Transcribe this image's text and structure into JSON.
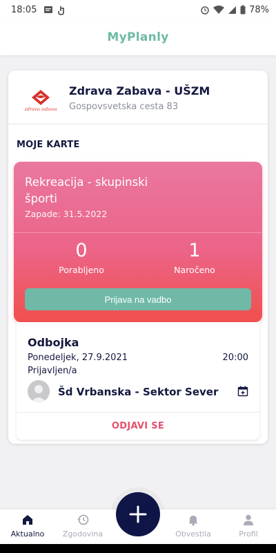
{
  "status_bar": {
    "time": "18:05",
    "battery": "78%"
  },
  "header": {
    "title": "MyPlanly"
  },
  "organization": {
    "name": "Zdrava Zabava - UŠZM",
    "address": "Gospovsvetska cesta 83",
    "logo_text": "zdrava zabava"
  },
  "section": {
    "title": "MOJE KARTE"
  },
  "ticket": {
    "title": "Rekreacija - skupinski športi",
    "valid_until": "Zapade: 31.5.2022",
    "used_count": "0",
    "used_label": "Porabljeno",
    "booked_count": "1",
    "booked_label": "Naročeno",
    "button_label": "Prijava na vadbo"
  },
  "session": {
    "title": "Odbojka",
    "date": "Ponedeljek, 27.9.2021",
    "time": "20:00",
    "status": "Prijavljen/a",
    "location": "Šd Vrbanska - Sektor Sever",
    "cancel_label": "ODJAVI SE"
  },
  "bottom_nav": {
    "items": [
      {
        "label": "Aktualno",
        "icon": "home-icon",
        "active": true
      },
      {
        "label": "Zgodovina",
        "icon": "history-icon",
        "active": false
      },
      {
        "label": "Obvestila",
        "icon": "bell-icon",
        "active": false
      },
      {
        "label": "Profil",
        "icon": "person-icon",
        "active": false
      }
    ]
  },
  "colors": {
    "accent": "#6fb9a6",
    "navy": "#0f1547",
    "ticket_top": "#e9779f",
    "ticket_bottom": "#f0504d",
    "danger": "#e4516c"
  }
}
